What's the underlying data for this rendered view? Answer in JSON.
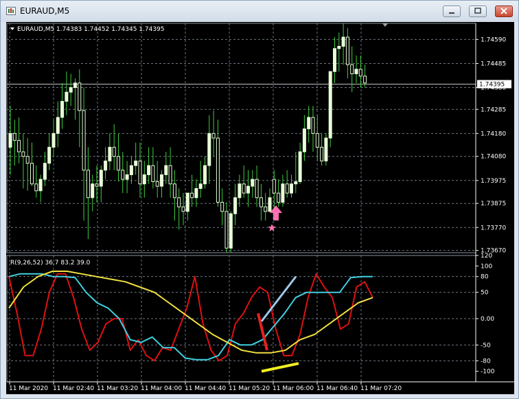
{
  "window": {
    "title": "EURAUD,M5"
  },
  "chart_header": {
    "symbol_ohlc": "EURAUD,M5  1.74383 1.74452 1.74345 1.74395"
  },
  "indicator_header": {
    "text": "R(9,26,52) 36.7 83.2 39.0"
  },
  "price_axis": {
    "labels": [
      "1.74590",
      "1.74485",
      "1.74380",
      "1.74285",
      "1.74180",
      "1.74080",
      "1.73975",
      "1.73875",
      "1.73770",
      "1.73670"
    ],
    "current_price": "1.74395"
  },
  "indicator_axis": {
    "labels": [
      "120",
      "100",
      "80",
      "50",
      "0.00",
      "-50",
      "-80",
      "-100"
    ]
  },
  "time_axis": {
    "labels": [
      "11 Mar 2020",
      "11 Mar 02:40",
      "11 Mar 03:20",
      "11 Mar 04:00",
      "11 Mar 04:40",
      "11 Mar 05:20",
      "11 Mar 06:00",
      "11 Mar 06:40",
      "11 Mar 07:20"
    ]
  },
  "colors": {
    "bull_candle": "#e8ffd8",
    "bear_candle": "#e8ffd8",
    "wick": "#3ecf3e",
    "grid": "#6e7885",
    "fast_line": "#e01010",
    "mid_line": "#40d0e0",
    "slow_line": "#f0e040",
    "arrow": "#ff70b0",
    "annotation_red": "#e82020",
    "annotation_blue": "#9ec8e8",
    "annotation_yellow": "#f0f020"
  },
  "chart_data": [
    {
      "type": "candlestick",
      "title": "EURAUD,M5",
      "ylim": [
        1.7366,
        1.7466
      ],
      "x": [
        "11 Mar 2020",
        "11 Mar 02:40",
        "11 Mar 03:20",
        "11 Mar 04:00",
        "11 Mar 04:40",
        "11 Mar 05:20",
        "11 Mar 06:00",
        "11 Mar 06:40",
        "11 Mar 07:20"
      ],
      "series": [
        {
          "open": [
            1.7412,
            1.7418,
            1.7415,
            1.741,
            1.7408,
            1.7405,
            1.7396,
            1.7393,
            1.7398,
            1.7405,
            1.7412,
            1.7418,
            1.7425,
            1.7432,
            1.7436,
            1.7438,
            1.744,
            1.7428,
            1.7402,
            1.739,
            1.7396,
            1.7395,
            1.7402,
            1.7406,
            1.7412,
            1.7408,
            1.7402,
            1.7398,
            1.74,
            1.7404,
            1.7406,
            1.7396,
            1.74,
            1.7404,
            1.7397,
            1.7395,
            1.74,
            1.7404,
            1.7396,
            1.739,
            1.7386,
            1.7384,
            1.7392,
            1.739,
            1.7394,
            1.7396,
            1.7404,
            1.7418,
            1.7416,
            1.7388,
            1.7384,
            1.7368,
            1.7383,
            1.739,
            1.7396,
            1.7392,
            1.7395,
            1.7398,
            1.739,
            1.7386,
            1.7384,
            1.7398,
            1.7392,
            1.7388,
            1.7396,
            1.7392,
            1.7396,
            1.7397,
            1.741,
            1.742,
            1.7425,
            1.7418,
            1.7412,
            1.7406,
            1.7416,
            1.7445,
            1.7455,
            1.7456,
            1.746,
            1.7448,
            1.7444,
            1.7446,
            1.7443
          ],
          "high": [
            1.743,
            1.7424,
            1.7425,
            1.7418,
            1.7416,
            1.7414,
            1.7404,
            1.74,
            1.741,
            1.7418,
            1.7424,
            1.7432,
            1.744,
            1.7445,
            1.7444,
            1.7442,
            1.7446,
            1.7438,
            1.7412,
            1.74,
            1.7404,
            1.7404,
            1.7412,
            1.7418,
            1.7422,
            1.7418,
            1.741,
            1.7406,
            1.7408,
            1.7414,
            1.7414,
            1.7406,
            1.7412,
            1.7412,
            1.7406,
            1.7402,
            1.741,
            1.7412,
            1.7402,
            1.7394,
            1.7392,
            1.7392,
            1.74,
            1.7398,
            1.7406,
            1.7408,
            1.7426,
            1.7428,
            1.7424,
            1.7394,
            1.7388,
            1.7384,
            1.7396,
            1.74,
            1.7404,
            1.7402,
            1.7402,
            1.7404,
            1.7396,
            1.7392,
            1.7394,
            1.7402,
            1.7398,
            1.74,
            1.7402,
            1.74,
            1.741,
            1.7414,
            1.7426,
            1.743,
            1.743,
            1.7426,
            1.7418,
            1.7418,
            1.7432,
            1.746,
            1.7462,
            1.7466,
            1.7464,
            1.7456,
            1.7452,
            1.7452,
            1.7448
          ],
          "low": [
            1.74,
            1.7404,
            1.7405,
            1.7394,
            1.7393,
            1.7395,
            1.739,
            1.7388,
            1.7395,
            1.7402,
            1.7408,
            1.7412,
            1.742,
            1.7426,
            1.743,
            1.7424,
            1.7412,
            1.738,
            1.7372,
            1.7384,
            1.7388,
            1.7388,
            1.7398,
            1.7402,
            1.7402,
            1.7397,
            1.7392,
            1.7392,
            1.7396,
            1.74,
            1.739,
            1.739,
            1.7396,
            1.7394,
            1.739,
            1.739,
            1.7396,
            1.739,
            1.738,
            1.7376,
            1.7378,
            1.738,
            1.7386,
            1.7386,
            1.739,
            1.7394,
            1.7396,
            1.7408,
            1.7386,
            1.7378,
            1.7366,
            1.7366,
            1.7378,
            1.7386,
            1.739,
            1.7386,
            1.739,
            1.7386,
            1.738,
            1.738,
            1.7384,
            1.7384,
            1.7386,
            1.7386,
            1.739,
            1.739,
            1.7392,
            1.7396,
            1.7406,
            1.7414,
            1.741,
            1.7406,
            1.7404,
            1.7404,
            1.7412,
            1.744,
            1.7445,
            1.7448,
            1.7442,
            1.7436,
            1.744,
            1.7438,
            1.7438
          ],
          "close": [
            1.7418,
            1.7415,
            1.741,
            1.7408,
            1.7405,
            1.7396,
            1.7393,
            1.7398,
            1.7405,
            1.7412,
            1.7418,
            1.7425,
            1.7432,
            1.7436,
            1.7438,
            1.744,
            1.7428,
            1.7402,
            1.739,
            1.7396,
            1.7395,
            1.7402,
            1.7406,
            1.7412,
            1.7408,
            1.7402,
            1.7398,
            1.74,
            1.7404,
            1.7406,
            1.7396,
            1.74,
            1.7404,
            1.7397,
            1.7395,
            1.74,
            1.7404,
            1.7396,
            1.739,
            1.7386,
            1.7384,
            1.7392,
            1.739,
            1.7394,
            1.7396,
            1.7404,
            1.7418,
            1.7416,
            1.7388,
            1.7384,
            1.7368,
            1.7383,
            1.739,
            1.7396,
            1.7392,
            1.7395,
            1.7398,
            1.739,
            1.7386,
            1.7384,
            1.739,
            1.7392,
            1.7388,
            1.7396,
            1.7392,
            1.7396,
            1.7397,
            1.741,
            1.742,
            1.7425,
            1.7418,
            1.7412,
            1.7406,
            1.7416,
            1.7445,
            1.7455,
            1.7456,
            1.746,
            1.7448,
            1.7444,
            1.7446,
            1.7443,
            1.744
          ]
        }
      ],
      "annotations": [
        {
          "type": "arrow-up",
          "near": "11 Mar 05:20-06:00"
        },
        {
          "type": "star",
          "near": "11 Mar 05:20-06:00"
        }
      ]
    },
    {
      "type": "line",
      "title": "R(9,26,52) 36.7 83.2 39.0",
      "ylim": [
        -120,
        120
      ],
      "series": [
        {
          "name": "",
          "color": "#e01010",
          "values": [
            80,
            10,
            -70,
            -70,
            -20,
            50,
            85,
            85,
            40,
            -20,
            -60,
            -45,
            -10,
            0,
            0,
            -60,
            -40,
            -70,
            -80,
            -55,
            -60,
            -20,
            20,
            80,
            -10,
            -60,
            -80,
            -70,
            -10,
            10,
            40,
            60,
            50,
            -20,
            -70,
            -70,
            -30,
            40,
            85,
            60,
            40,
            -20,
            -10,
            60,
            70,
            40
          ]
        },
        {
          "name": "",
          "color": "#40d0e0",
          "values": [
            80,
            85,
            85,
            85,
            80,
            80,
            78,
            50,
            30,
            20,
            0,
            -40,
            -45,
            -35,
            -55,
            -55,
            -75,
            -78,
            -78,
            -70,
            -40,
            -50,
            -50,
            -40,
            -15,
            10,
            40,
            50,
            50,
            50,
            50,
            78,
            80,
            80
          ]
        },
        {
          "name": "",
          "color": "#f0e040",
          "values": [
            20,
            60,
            80,
            90,
            90,
            85,
            80,
            75,
            70,
            60,
            50,
            30,
            10,
            -10,
            -30,
            -45,
            -60,
            -65,
            -65,
            -60,
            -40,
            -30,
            -10,
            10,
            30,
            40
          ]
        }
      ]
    }
  ]
}
